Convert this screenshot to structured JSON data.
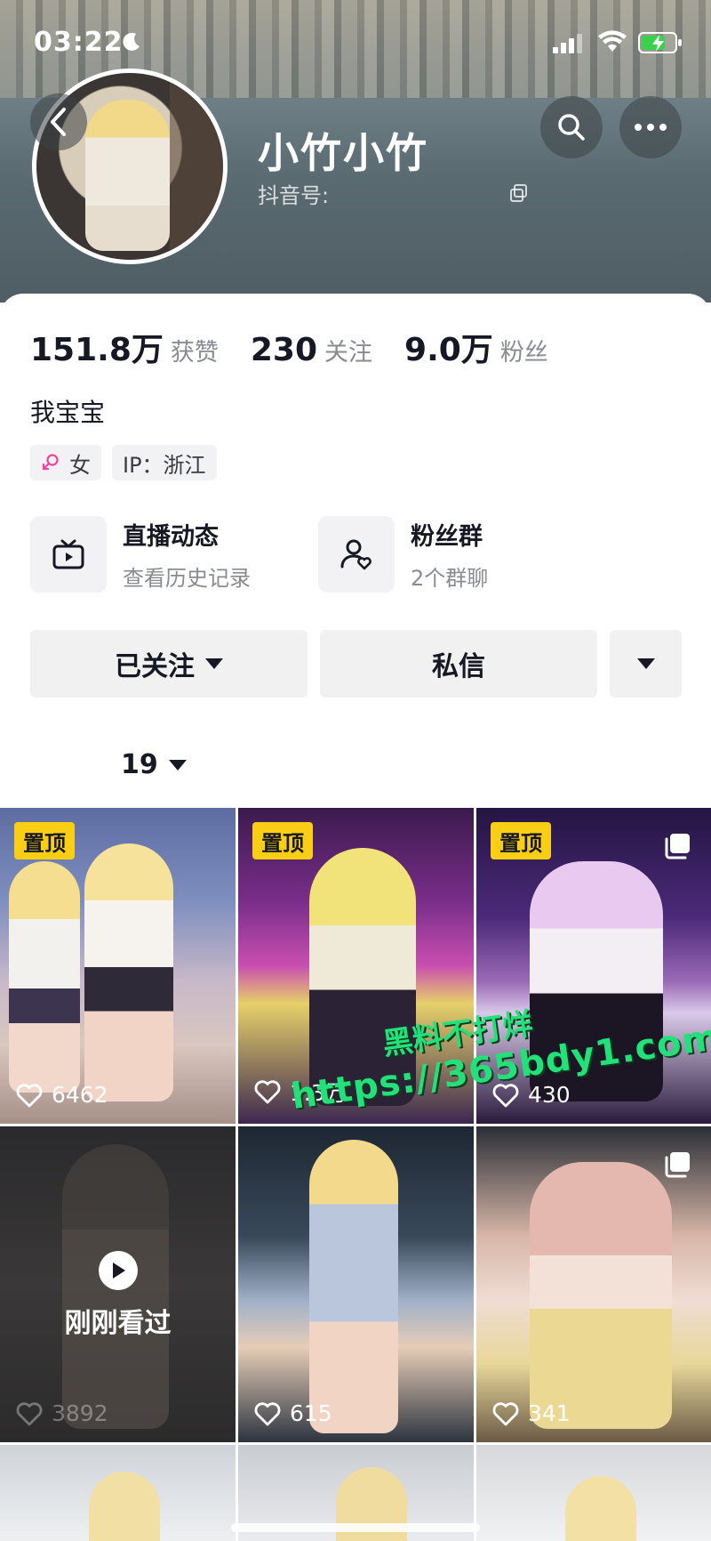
{
  "status_bar": {
    "time": "03:22"
  },
  "profile": {
    "nickname": "小竹小竹",
    "douyin_id_label": "抖音号:",
    "stats": [
      {
        "value": "151.8万",
        "label": "获赞"
      },
      {
        "value": "230",
        "label": "关注"
      },
      {
        "value": "9.0万",
        "label": "粉丝"
      }
    ],
    "bio": "我宝宝",
    "tags": {
      "gender": "女",
      "ip": "IP：浙江"
    }
  },
  "features": {
    "live": {
      "title": "直播动态",
      "subtitle": "查看历史记录"
    },
    "fans": {
      "title": "粉丝群",
      "subtitle": "2个群聊"
    }
  },
  "actions": {
    "followed": "已关注",
    "message": "私信"
  },
  "works_tab": {
    "count": "19"
  },
  "videos": [
    {
      "pinned": "置顶",
      "likes": "6462"
    },
    {
      "pinned": "置顶",
      "likes": "1.3万"
    },
    {
      "pinned": "置顶",
      "likes": "430"
    },
    {
      "likes": "3892",
      "overlay": "刚刚看过"
    },
    {
      "likes": "615"
    },
    {
      "likes": "341"
    }
  ],
  "watermark": {
    "line1": "黑料不打烊",
    "line2": "https://365bdy1.com"
  },
  "colors": {
    "accent_yellow": "#face15",
    "watermark_green": "#23e07a"
  }
}
